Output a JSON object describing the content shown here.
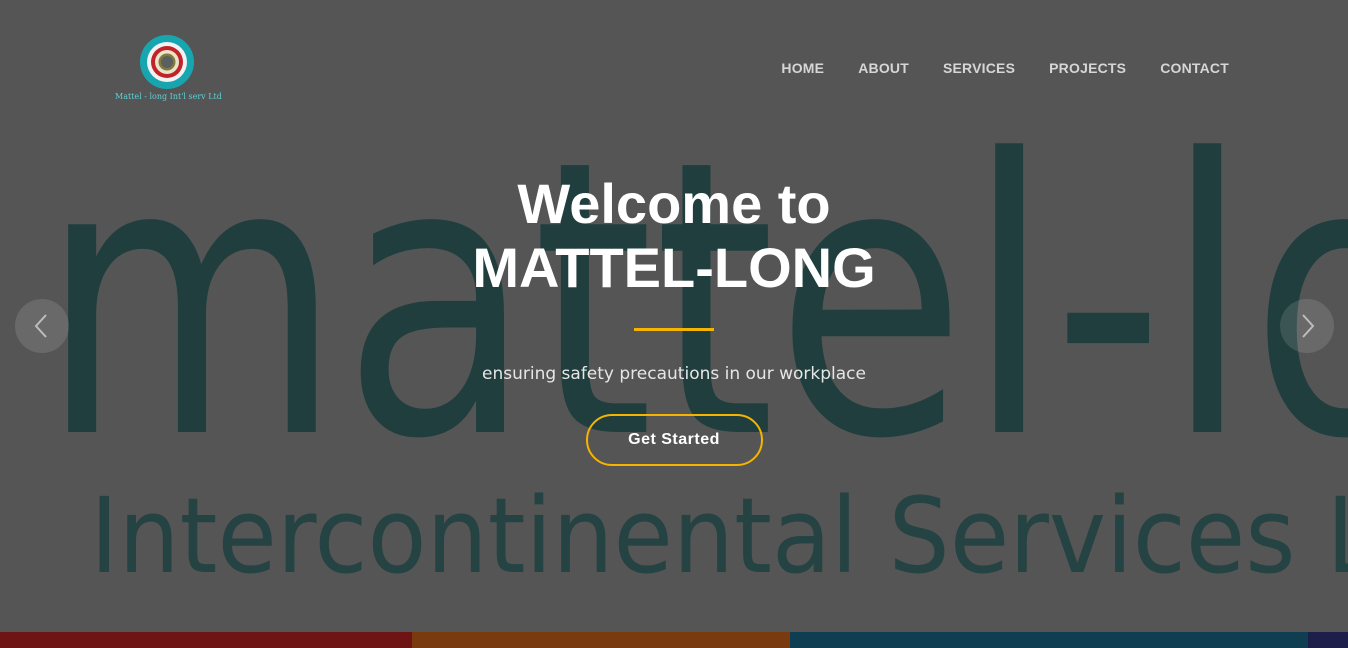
{
  "brand": {
    "logo_text": "Mattel - long Int'l serv Ltd",
    "logo_icon": "concentric-rings-logo-icon"
  },
  "nav": {
    "items": [
      "HOME",
      "ABOUT",
      "SERVICES",
      "PROJECTS",
      "CONTACT"
    ]
  },
  "hero": {
    "background_word": "mattel-lo",
    "background_subtitle": "Intercontinental Services L",
    "title_line1": "Welcome to",
    "title_line2": "MATTEL-LONG",
    "subtitle": "ensuring safety precautions in our workplace",
    "cta_label": "Get Started"
  },
  "carousel": {
    "prev_icon": "chevron-left-icon",
    "next_icon": "chevron-right-icon"
  },
  "colors": {
    "accent": "#f4b400",
    "overlay": "#555555",
    "brand_teal": "#0f3a39",
    "strip": [
      "#6e1414",
      "#7a3a10",
      "#0f3d52",
      "#1e1e4a"
    ]
  }
}
